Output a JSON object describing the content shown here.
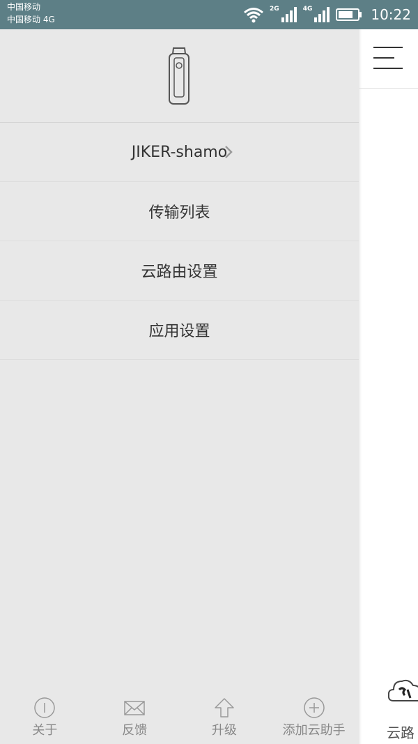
{
  "status_bar": {
    "carrier_line1": "中国移动",
    "carrier_line2": "中国移动 4G",
    "net_tag_1": "2G",
    "net_tag_2": "4G",
    "time": "10:22"
  },
  "drawer": {
    "device_name": "JIKER-shamo",
    "menu": [
      {
        "label": "传输列表"
      },
      {
        "label": "云路由设置"
      },
      {
        "label": "应用设置"
      }
    ],
    "bottom": [
      {
        "label": "关于",
        "icon": "info-circle-icon"
      },
      {
        "label": "反馈",
        "icon": "envelope-icon"
      },
      {
        "label": "升级",
        "icon": "arrow-up-icon"
      },
      {
        "label": "添加云助手",
        "icon": "plus-circle-icon"
      }
    ]
  },
  "main": {
    "peek_label": "云路"
  }
}
